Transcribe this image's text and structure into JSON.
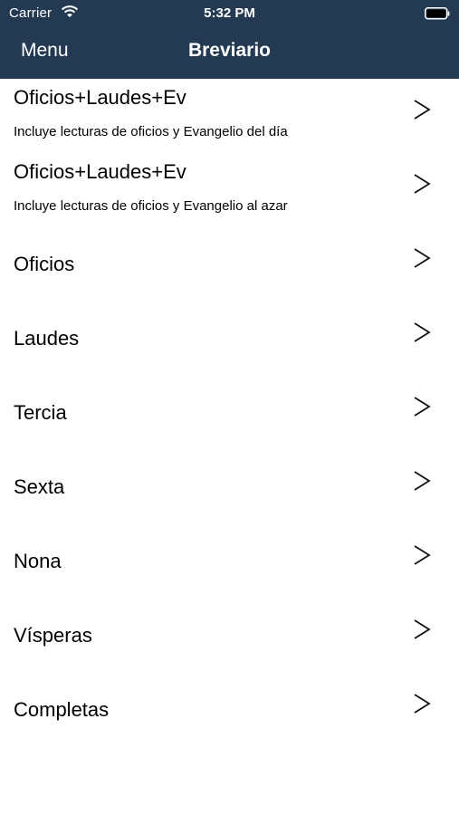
{
  "status_bar": {
    "carrier": "Carrier",
    "time": "5:32 PM",
    "wifi_icon": "wifi-icon",
    "battery_icon": "battery-icon"
  },
  "nav_bar": {
    "menu_label": "Menu",
    "title": "Breviario",
    "background_color": "#243a52"
  },
  "list": {
    "items": [
      {
        "title": "Oficios+Laudes+Ev",
        "subtitle": "Incluye lecturas de oficios y Evangelio del día",
        "icon": "chevron-right-icon"
      },
      {
        "title": "Oficios+Laudes+Ev",
        "subtitle": "Incluye lecturas de oficios y Evangelio al azar",
        "icon": "chevron-right-icon"
      },
      {
        "title": "Oficios",
        "icon": "chevron-right-icon"
      },
      {
        "title": "Laudes",
        "icon": "chevron-right-icon"
      },
      {
        "title": "Tercia",
        "icon": "chevron-right-icon"
      },
      {
        "title": "Sexta",
        "icon": "chevron-right-icon"
      },
      {
        "title": "Nona",
        "icon": "chevron-right-icon"
      },
      {
        "title": "Vísperas",
        "icon": "chevron-right-icon"
      },
      {
        "title": "Completas",
        "icon": "chevron-right-icon"
      }
    ]
  }
}
